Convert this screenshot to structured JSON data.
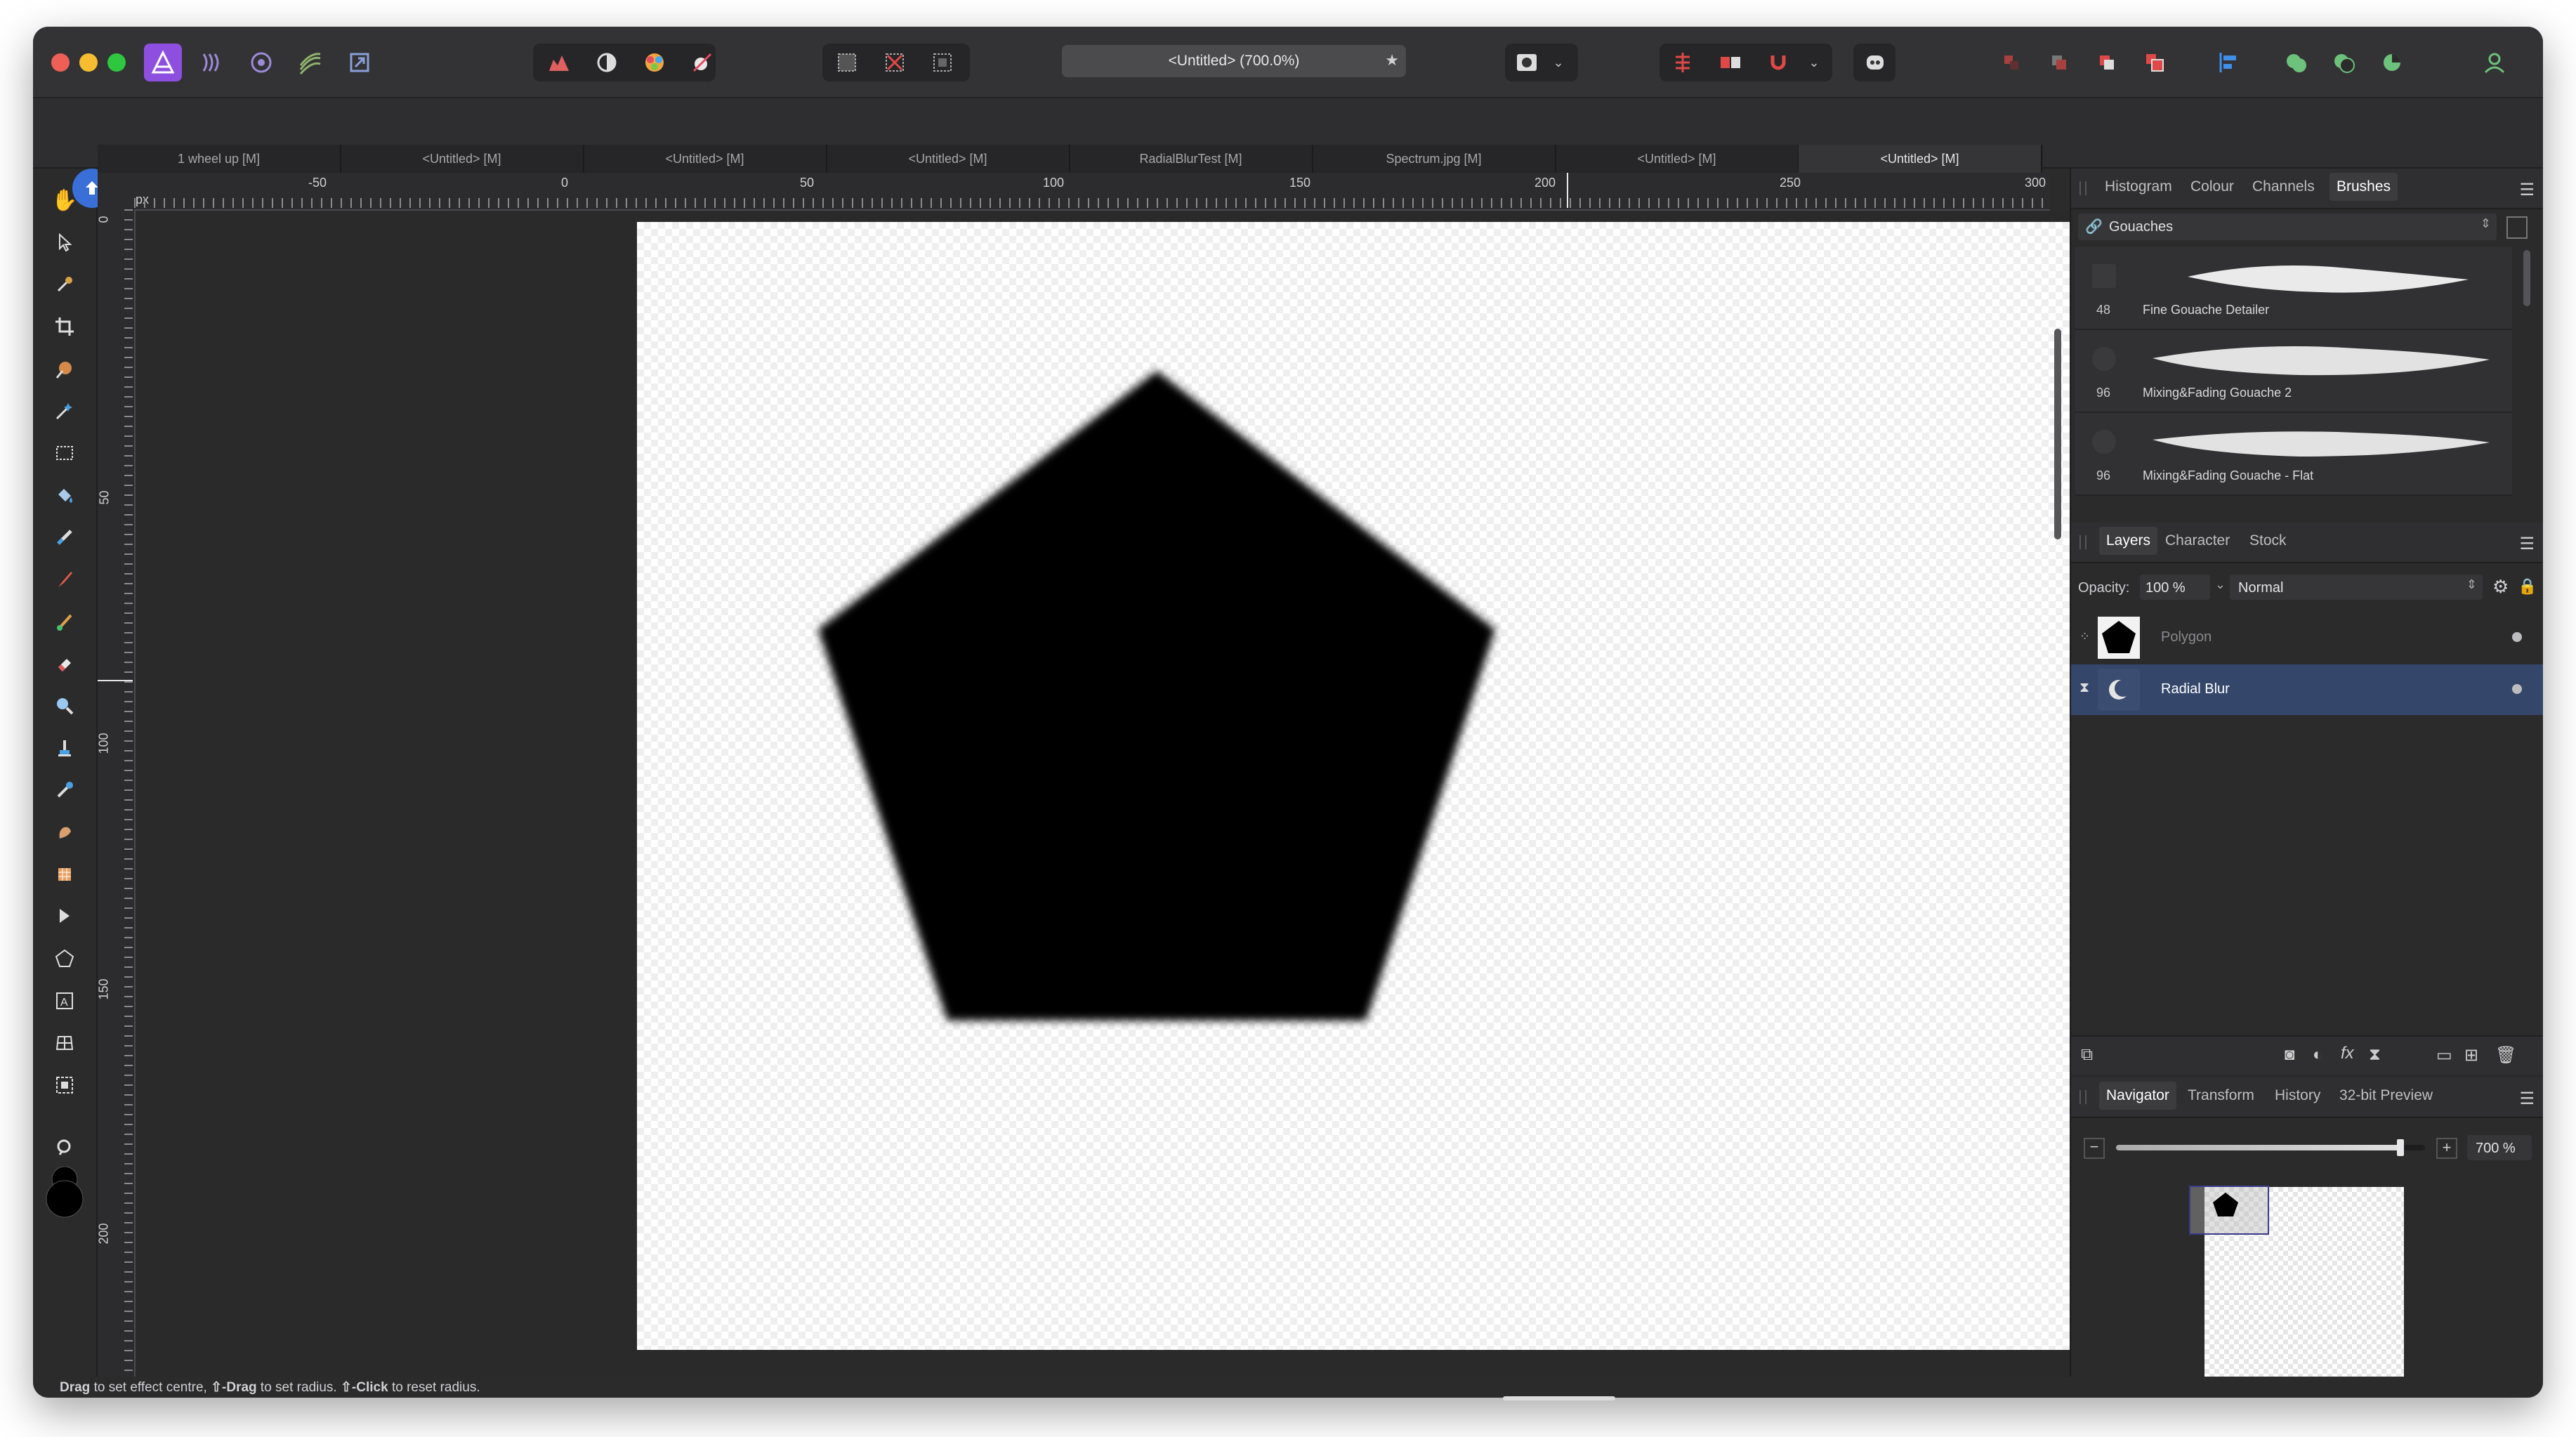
{
  "window": {
    "title": "<Untitled> (700.0%)"
  },
  "doc_tabs": [
    {
      "label": "1 wheel up [M]"
    },
    {
      "label": "<Untitled> [M]"
    },
    {
      "label": "<Untitled> [M]"
    },
    {
      "label": "<Untitled> [M]"
    },
    {
      "label": "RadialBlurTest [M]"
    },
    {
      "label": "Spectrum.jpg [M]"
    },
    {
      "label": "<Untitled> [M]"
    },
    {
      "label": "<Untitled> [M]",
      "active": true
    }
  ],
  "ruler": {
    "unit": "px",
    "h_labels": [
      "-50",
      "0",
      "50",
      "100",
      "150",
      "200",
      "250",
      "300"
    ],
    "v_labels": [
      "0",
      "50",
      "100",
      "150",
      "200"
    ]
  },
  "brushes_panel": {
    "tabs": [
      "Histogram",
      "Colour",
      "Channels",
      "Brushes"
    ],
    "active_tab": "Brushes",
    "category": "Gouaches",
    "items": [
      {
        "size": "48",
        "name": "Fine Gouache Detailer"
      },
      {
        "size": "96",
        "name": "Mixing&Fading Gouache 2"
      },
      {
        "size": "96",
        "name": "Mixing&Fading Gouache - Flat"
      }
    ]
  },
  "layers_panel": {
    "tabs": [
      "Layers",
      "Character",
      "Stock"
    ],
    "active_tab": "Layers",
    "opacity_label": "Opacity:",
    "opacity_value": "100 %",
    "blend_mode": "Normal",
    "layers": [
      {
        "name": "Polygon",
        "selected": false
      },
      {
        "name": "Radial Blur",
        "selected": true
      }
    ]
  },
  "navigator_panel": {
    "tabs": [
      "Navigator",
      "Transform",
      "History",
      "32-bit Preview"
    ],
    "active_tab": "Navigator",
    "zoom_value": "700 %",
    "zoom_level": 0.92
  },
  "status": {
    "k1": "Drag",
    "t1": " to set effect centre, ",
    "k2": "⇧-Drag",
    "t2": " to set radius. ",
    "k3": "⇧-Click",
    "t3": " to reset radius."
  },
  "colors": {
    "accent": "#3a6fd8",
    "selected_layer": "#34476b",
    "app_bg": "#2b2b2c"
  }
}
